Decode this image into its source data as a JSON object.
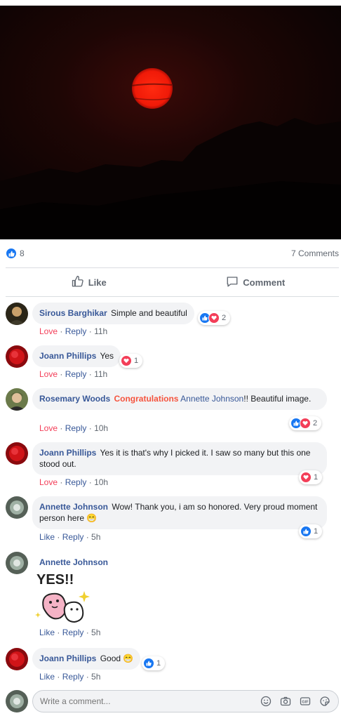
{
  "post": {
    "reaction_count": "8",
    "comments_count": "7 Comments",
    "like_label": "Like",
    "comment_label": "Comment"
  },
  "comments": [
    {
      "name": "Sirous Barghikar",
      "text": "Simple and beautiful",
      "reaction": "Love",
      "reply": "Reply",
      "time": "11h",
      "rx_count": "2"
    },
    {
      "name": "Joann Phillips",
      "text": "Yes",
      "reaction": "Love",
      "reply": "Reply",
      "time": "11h",
      "rx_count": "1"
    },
    {
      "name": "Rosemary Woods",
      "highlight": "Congratulations",
      "tag": "Annette Johnson",
      "text": "!! Beautiful image.",
      "reaction": "Love",
      "reply": "Reply",
      "time": "10h",
      "rx_count": "2"
    },
    {
      "name": "Joann Phillips",
      "text": "Yes it is that's why I picked it. I saw so many but this one stood out.",
      "reaction": "Love",
      "reply": "Reply",
      "time": "10h",
      "rx_count": "1"
    },
    {
      "name": "Annette Johnson",
      "text": "Wow! Thank you, i am so honored. Very proud moment person here 😁",
      "reaction": "Like",
      "reply": "Reply",
      "time": "5h",
      "rx_count": "1"
    },
    {
      "name": "Annette Johnson",
      "sticker_text": "YES!!",
      "reaction": "Like",
      "reply": "Reply",
      "time": "5h"
    },
    {
      "name": "Joann Phillips",
      "text": "Good 😁",
      "reaction": "Like",
      "reply": "Reply",
      "time": "5h",
      "rx_count": "1"
    }
  ],
  "composer": {
    "placeholder": "Write a comment...",
    "icons": [
      "emoji-icon",
      "camera-icon",
      "gif-icon",
      "sticker-icon"
    ]
  },
  "colors": {
    "link": "#385898",
    "love": "#f33e58",
    "like": "#1877f2",
    "highlight": "#f5533d",
    "bubble": "#f2f3f5"
  }
}
